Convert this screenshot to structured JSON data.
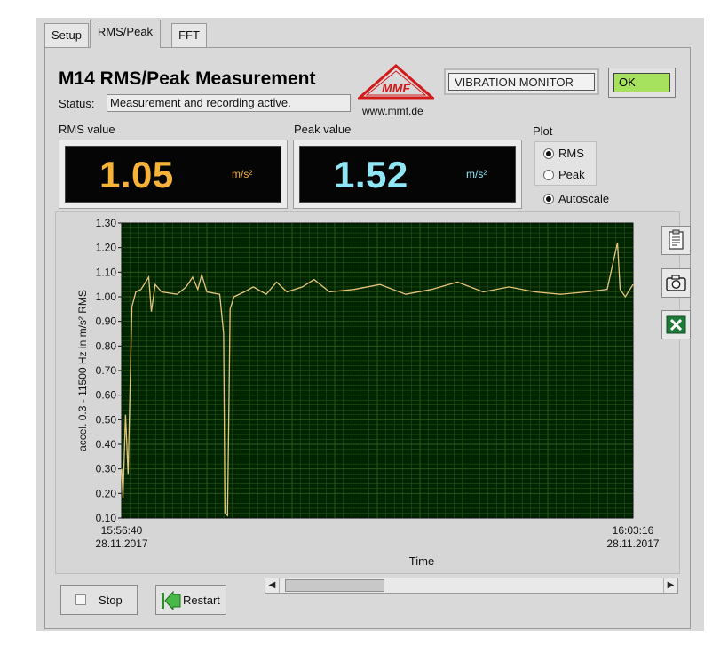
{
  "tabs": [
    {
      "label": "Setup",
      "active": false
    },
    {
      "label": "RMS/Peak",
      "active": true
    },
    {
      "label": "FFT",
      "active": false
    }
  ],
  "header": {
    "title": "M14 RMS/Peak Measurement",
    "status_label": "Status:",
    "status_value": "Measurement and recording active.",
    "logo_text": "MMF",
    "logo_url": "www.mmf.de",
    "device_name": "VIBRATION MONITOR",
    "ok_label": "OK"
  },
  "meters": {
    "rms": {
      "label": "RMS value",
      "value": "1.05",
      "unit": "m/s²"
    },
    "peak": {
      "label": "Peak value",
      "value": "1.52",
      "unit": "m/s²"
    }
  },
  "plot_options": {
    "label": "Plot",
    "rms_label": "RMS",
    "peak_label": "Peak",
    "autoscale_label": "Autoscale",
    "selected": "RMS",
    "autoscale": true
  },
  "colors": {
    "rms_value": "#f7b23a",
    "peak_value": "#8fe6f5",
    "plot_bg": "#002400",
    "grid": "#2c5c1c",
    "trace": "#e8c478"
  },
  "icons": {
    "copy": "clipboard-icon",
    "snapshot": "camera-icon",
    "export": "excel-icon",
    "restart": "restart-arrow-icon"
  },
  "chart_data": {
    "type": "line",
    "title": "",
    "xlabel": "Time",
    "ylabel": "accel. 0.3 - 11500 Hz in m/s² RMS",
    "ylim": [
      0.1,
      1.3
    ],
    "yticks": [
      "0.10",
      "0.20",
      "0.30",
      "0.40",
      "0.50",
      "0.60",
      "0.70",
      "0.80",
      "0.90",
      "1.00",
      "1.10",
      "1.20",
      "1.30"
    ],
    "x_start": {
      "time": "15:56:40",
      "date": "28.11.2017"
    },
    "x_end": {
      "time": "16:03:16",
      "date": "28.11.2017"
    },
    "xlim": [
      "15:56:40",
      "16:03:16"
    ],
    "grid": true,
    "series": [
      {
        "points": [
          [
            "15:56:40",
            0.3
          ],
          [
            "15:56:41",
            0.18
          ],
          [
            "15:56:43",
            0.52
          ],
          [
            "15:56:45",
            0.28
          ],
          [
            "15:56:48",
            0.96
          ],
          [
            "15:56:51",
            1.02
          ],
          [
            "15:56:55",
            1.03
          ],
          [
            "15:57:01",
            1.08
          ],
          [
            "15:57:03",
            0.94
          ],
          [
            "15:57:06",
            1.05
          ],
          [
            "15:57:11",
            1.02
          ],
          [
            "15:57:23",
            1.01
          ],
          [
            "15:57:30",
            1.04
          ],
          [
            "15:57:35",
            1.08
          ],
          [
            "15:57:39",
            1.03
          ],
          [
            "15:57:42",
            1.09
          ],
          [
            "15:57:46",
            1.02
          ],
          [
            "15:57:56",
            1.01
          ],
          [
            "15:57:59",
            0.85
          ],
          [
            "15:58:00",
            0.12
          ],
          [
            "15:58:02",
            0.11
          ],
          [
            "15:58:04",
            0.95
          ],
          [
            "15:58:07",
            1.0
          ],
          [
            "15:58:15",
            1.02
          ],
          [
            "15:58:22",
            1.04
          ],
          [
            "15:58:32",
            1.01
          ],
          [
            "15:58:40",
            1.06
          ],
          [
            "15:58:48",
            1.02
          ],
          [
            "15:59:00",
            1.04
          ],
          [
            "15:59:09",
            1.07
          ],
          [
            "15:59:21",
            1.02
          ],
          [
            "15:59:40",
            1.03
          ],
          [
            "16:00:00",
            1.05
          ],
          [
            "16:00:20",
            1.01
          ],
          [
            "16:00:40",
            1.03
          ],
          [
            "16:01:00",
            1.06
          ],
          [
            "16:01:20",
            1.02
          ],
          [
            "16:01:40",
            1.04
          ],
          [
            "16:02:00",
            1.02
          ],
          [
            "16:02:20",
            1.01
          ],
          [
            "16:02:40",
            1.02
          ],
          [
            "16:02:56",
            1.03
          ],
          [
            "16:03:04",
            1.22
          ],
          [
            "16:03:06",
            1.03
          ],
          [
            "16:03:10",
            1.0
          ],
          [
            "16:03:16",
            1.05
          ]
        ]
      }
    ]
  },
  "controls": {
    "stop_label": "Stop",
    "restart_label": "Restart"
  }
}
